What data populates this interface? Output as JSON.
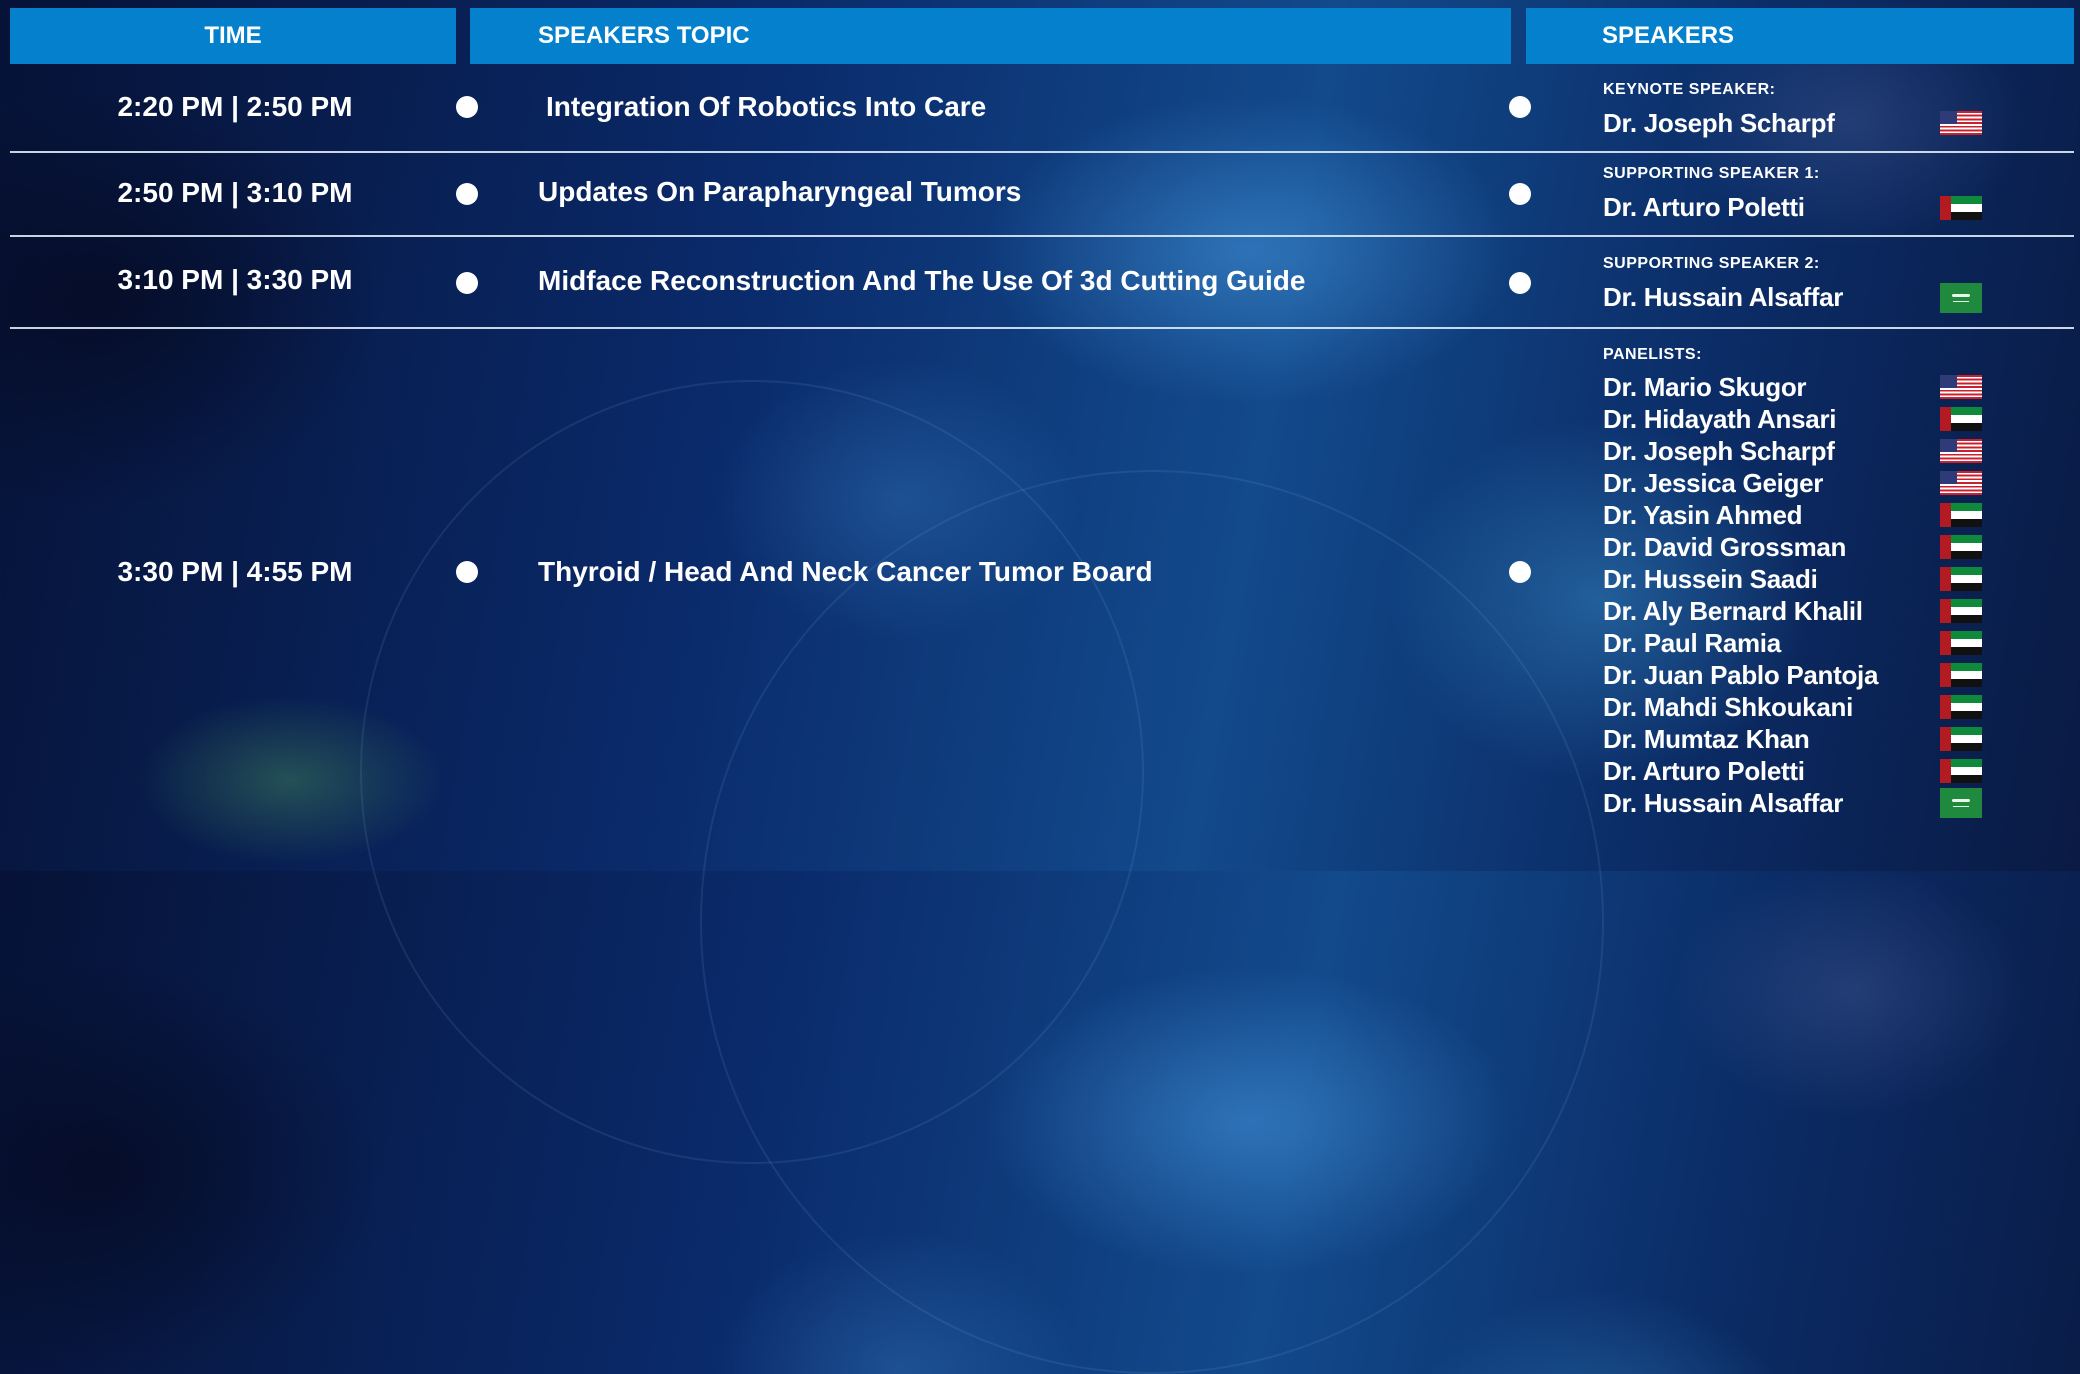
{
  "header": {
    "time": "TIME",
    "topic": "SPEAKERS TOPIC",
    "speakers": "SPEAKERS"
  },
  "sessions": [
    {
      "time": "2:20 PM | 2:50 PM",
      "topic": "Integration Of Robotics Into Care",
      "role": "KEYNOTE SPEAKER:",
      "name": "Dr. Joseph Scharpf",
      "flag": "us-flag-icon"
    },
    {
      "time": "2:50 PM | 3:10 PM",
      "topic": "Updates On Parapharyngeal Tumors",
      "role": "SUPPORTING SPEAKER 1:",
      "name": "Dr. Arturo Poletti",
      "flag": "uae-flag-icon"
    },
    {
      "time": "3:10 PM | 3:30 PM",
      "topic": "Midface Reconstruction And The Use Of 3d Cutting Guide",
      "role": "SUPPORTING SPEAKER 2:",
      "name": "Dr. Hussain Alsaffar",
      "flag": "saudi-flag-icon"
    },
    {
      "time": "3:30 PM | 4:55 PM",
      "topic": "Thyroid / Head And Neck Cancer Tumor Board",
      "role": "PANELISTS:"
    }
  ],
  "panelists": [
    {
      "name": "Dr. Mario Skugor",
      "flag": "us-flag-icon"
    },
    {
      "name": "Dr. Hidayath Ansari",
      "flag": "uae-flag-icon"
    },
    {
      "name": "Dr. Joseph Scharpf",
      "flag": "us-flag-icon"
    },
    {
      "name": "Dr. Jessica Geiger",
      "flag": "us-flag-icon"
    },
    {
      "name": "Dr. Yasin Ahmed",
      "flag": "uae-flag-icon"
    },
    {
      "name": "Dr. David Grossman",
      "flag": "uae-flag-icon"
    },
    {
      "name": "Dr. Hussein Saadi",
      "flag": "uae-flag-icon"
    },
    {
      "name": "Dr. Aly Bernard Khalil",
      "flag": "uae-flag-icon"
    },
    {
      "name": "Dr. Paul Ramia",
      "flag": "uae-flag-icon"
    },
    {
      "name": "Dr. Juan Pablo Pantoja",
      "flag": "uae-flag-icon"
    },
    {
      "name": "Dr. Mahdi Shkoukani",
      "flag": "uae-flag-icon"
    },
    {
      "name": "Dr. Mumtaz Khan",
      "flag": "uae-flag-icon"
    },
    {
      "name": "Dr. Arturo Poletti",
      "flag": "uae-flag-icon"
    },
    {
      "name": "Dr. Hussain Alsaffar",
      "flag": "saudi-flag-icon"
    }
  ],
  "colors": {
    "header_bar": "#0580cc",
    "background": "#0a2a6a",
    "text": "#ffffff"
  }
}
